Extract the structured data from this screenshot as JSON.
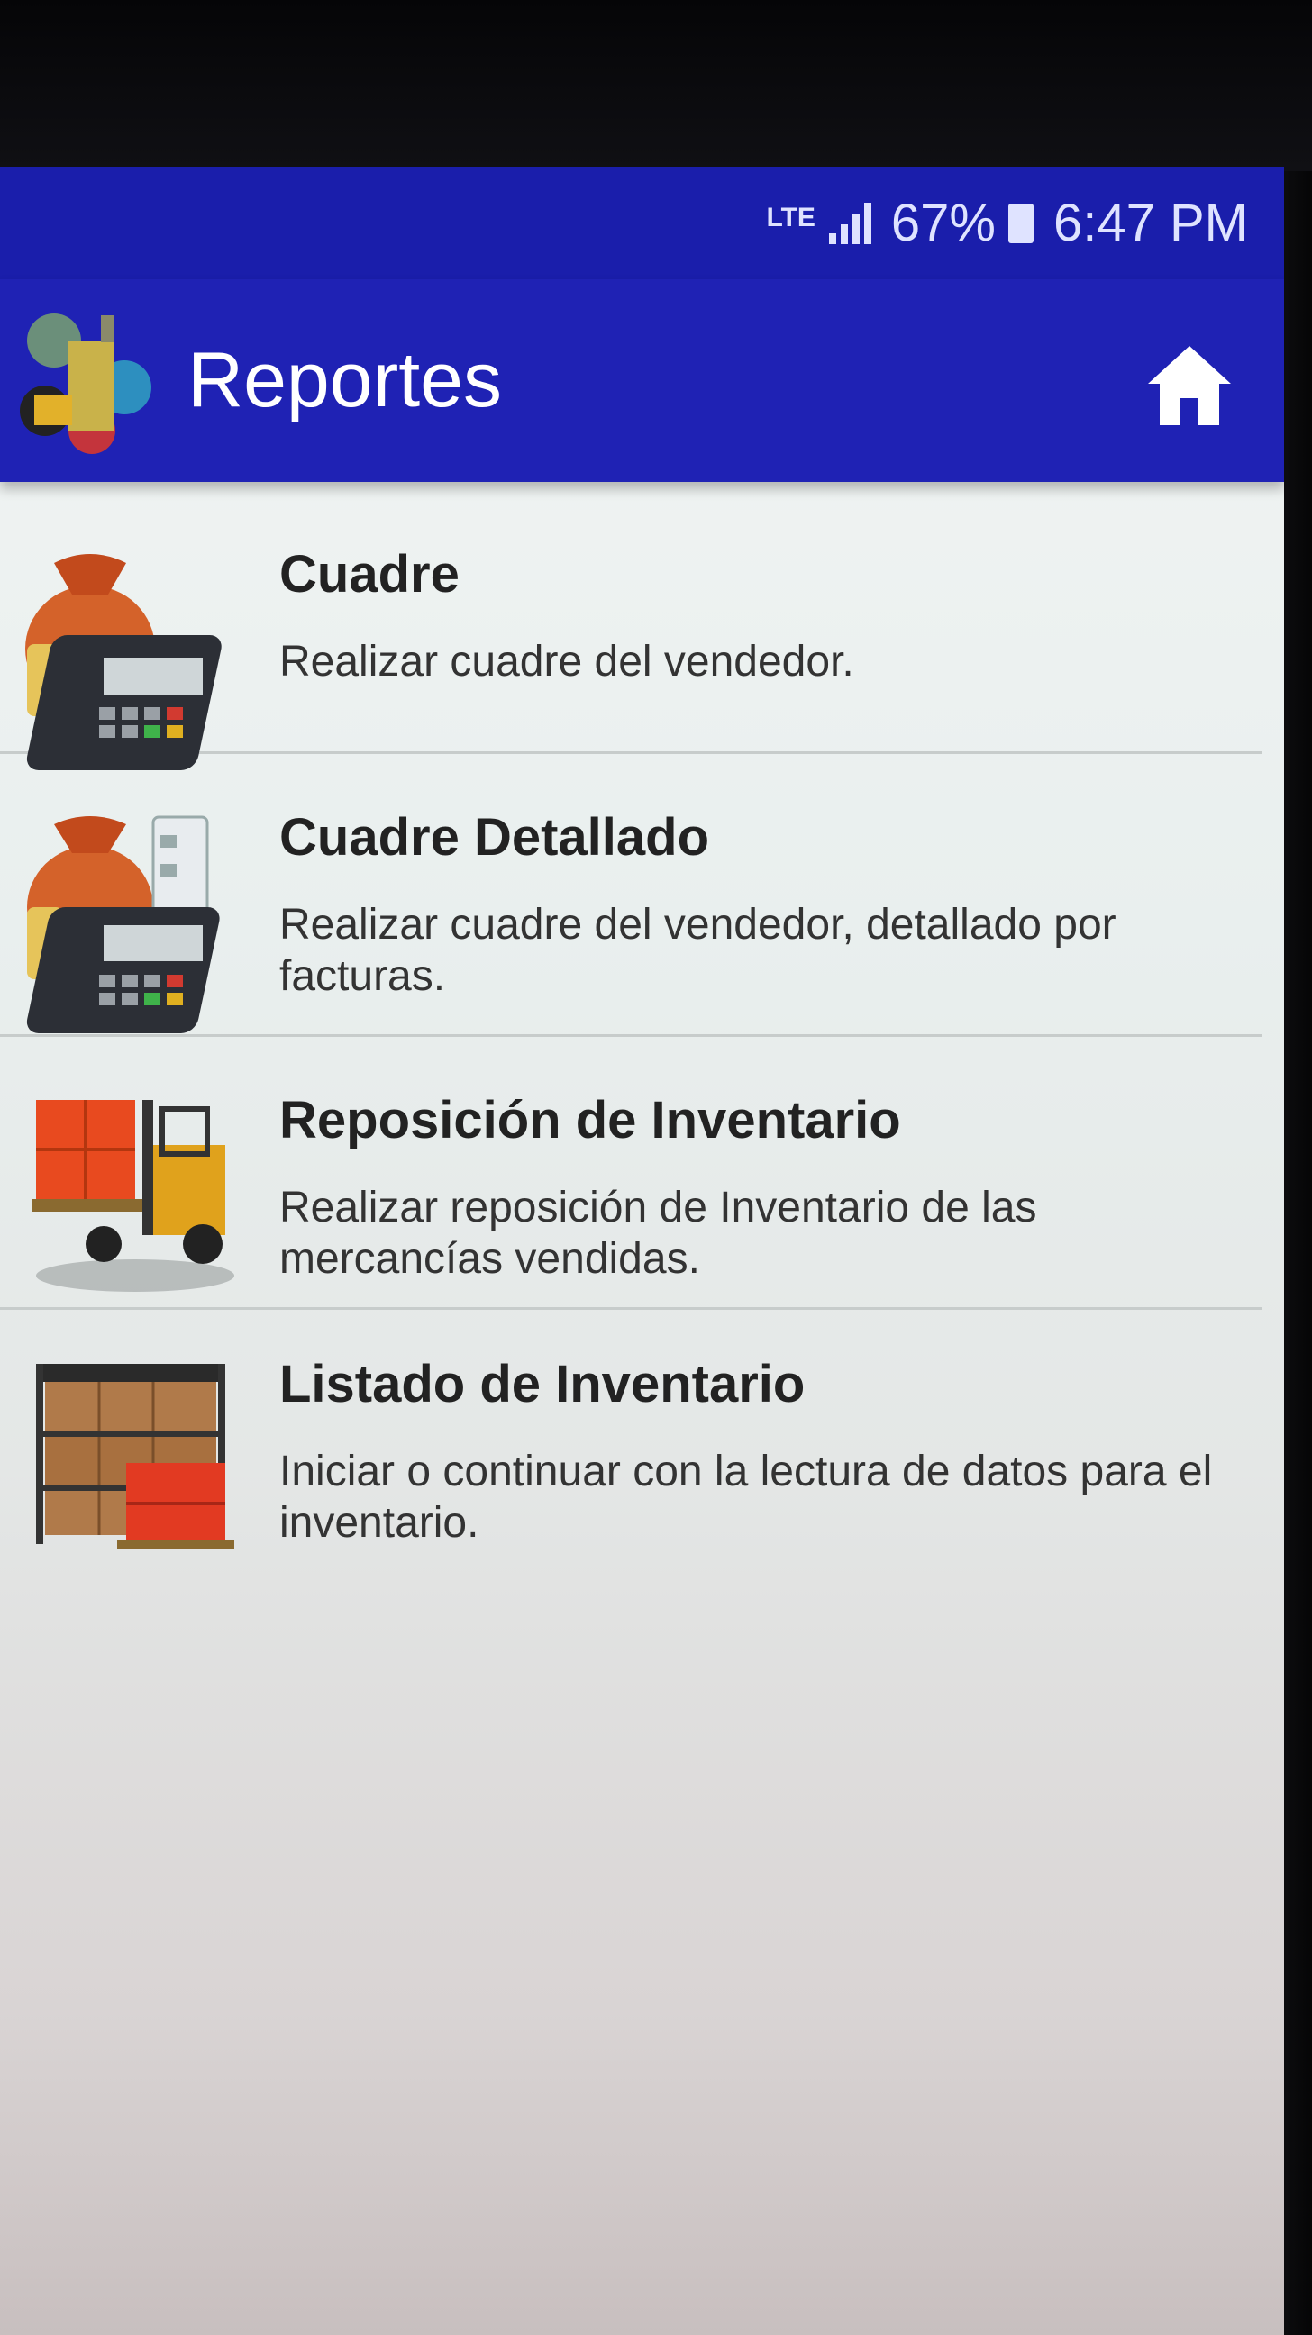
{
  "status_bar": {
    "network": "LTE",
    "battery_percent": "67%",
    "time": "6:47 PM"
  },
  "app_bar": {
    "title": "Reportes",
    "logo_icon": "app-logo-icon",
    "home_icon": "home-icon"
  },
  "colors": {
    "status_bar": "#1a1eab",
    "app_bar": "#1f22b4",
    "background": "#eef3f2"
  },
  "menu": {
    "items": [
      {
        "icon": "money-bag-pos-icon",
        "title": "Cuadre",
        "description": "Realizar cuadre del vendedor."
      },
      {
        "icon": "money-bag-pos-checklist-icon",
        "title": "Cuadre Detallado",
        "description": "Realizar cuadre del vendedor, detallado por facturas."
      },
      {
        "icon": "forklift-boxes-icon",
        "title": "Reposición de Inventario",
        "description": "Realizar reposición de Inventario de las mercancías vendidas."
      },
      {
        "icon": "warehouse-shelf-icon",
        "title": "Listado de Inventario",
        "description": "Iniciar o continuar con la lectura de datos para el inventario."
      }
    ]
  }
}
